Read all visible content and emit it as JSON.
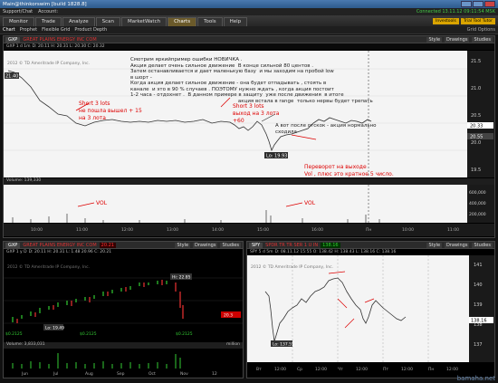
{
  "window": {
    "title": "Main@thinkorswim [build 1828.8]"
  },
  "menubar": {
    "items": [
      "Support/Chat",
      "Account:"
    ],
    "status": "Connected 13.11.12 09:11:54 MSK"
  },
  "tabs": [
    "Monitor",
    "Trade",
    "Analyze",
    "Scan",
    "MarketWatch",
    "Charts",
    "Tools",
    "Help"
  ],
  "tab_right": [
    "Investools",
    "Trial Tool Tutor"
  ],
  "subtabs": [
    "Chart",
    "Prophet",
    "Flexible Grid",
    "Product Depth"
  ],
  "subtabs_right": "Grid Options",
  "main": {
    "symbol": "GXP",
    "name": "GREAT PLAINS ENERGY INC COM",
    "period": "GXP 1 d 1m",
    "ohlc": "D: 20.11 H: 20.31 L: 20.30 C: 20.32",
    "copyright": "2012 © TD Ameritrade IP Company, Inc.",
    "toolbar": [
      "Style",
      "Drawings",
      "Studies"
    ],
    "price_labels": [
      "21.40",
      "20.33",
      "20.55",
      "20.1",
      "21.5",
      "21.0",
      "20.5",
      "20.0",
      "19.5"
    ],
    "lo_label": "Lo: 19.93",
    "volume_label": "Volume: 139,330",
    "volume_axis": [
      "600,000",
      "400,000",
      "200,000"
    ],
    "time_labels": [
      "10:00",
      "11:00",
      "12:00",
      "13:00",
      "14:00",
      "15:00",
      "16:00",
      "Пн",
      "10:00",
      "11:00"
    ],
    "note_main": "Смотрим яркийпример ошибки НОВИЧКА .\nАкция делает очень сильное движение  В конце сильной 80 центов .\nЗатем останавливается и дает маленькую базу  и мы заходим на пробой low\nв шорт -\nКогда акция делает сильное движение - она будет отпадывать , стоять в\nканале  и это в 90 % случаев . ПОЭТОМУ нужно ждать , когда акция постоит\n1-2 часа - отдохнет .  В данном примере в защиту  уже после движения  в итоге\n                                                                    акция встала в range  только нервы будет трепать",
    "note_bottom": "А вот после отскок - акция нормально\nсходила",
    "red_note_1": "Short 3 lots\nне пошла вышел + 15\nна 3 лота",
    "red_note_2": "Short 3 lots\nвыход на 3 лота\n+60",
    "red_note_3": "Переворот на выходе\nVol , плюс это кратное 5 число.\n3 лота  + 60",
    "vol_note_1": "VOL",
    "vol_note_2": "VOL"
  },
  "left_panel": {
    "symbol": "GXP",
    "name": "GREAT PLAINS ENERGY INC COM",
    "price": "20.21",
    "period": "GXP 1 y D",
    "ohlc": "D: 20.11 H: 20.31 L: 1.48 20.96 C: 20.21",
    "copyright": "2012 © TD Ameritrade IP Company, Inc.",
    "hi_label": "Hi: 22.85",
    "labels_left": [
      "$0.2125",
      "$0.2125"
    ],
    "lo_label": "Lo: 19.49",
    "price_end": "$0.2125",
    "tag": "20.3",
    "volume_label": "Volume: 3,833,031",
    "volume_right": "million",
    "time_labels": [
      "Jun",
      "Jul",
      "Aug",
      "Sep",
      "Oct",
      "Nov",
      "12"
    ]
  },
  "right_panel": {
    "symbol": "SPY",
    "name": "SPDR TR TR SER 1 U IN",
    "price": "138.16",
    "period": "SPY 5 d 5m",
    "ohlc": "D: 08.11.12 15:55  O: 138.42  H: 138.43  L: 138.16  C: 138.16",
    "copyright": "2012 © TD Ameritrade IP Company, Inc.",
    "lo_label": "Lo: 137.55",
    "price_axis": [
      "141",
      "140",
      "139",
      "138",
      "137"
    ],
    "time_labels": [
      "Вт",
      "12:00",
      "Ср",
      "12:00",
      "Чт",
      "12:00",
      "Пт",
      "12:00",
      "Пн",
      "12:00"
    ]
  },
  "footer": "bamaha.net"
}
